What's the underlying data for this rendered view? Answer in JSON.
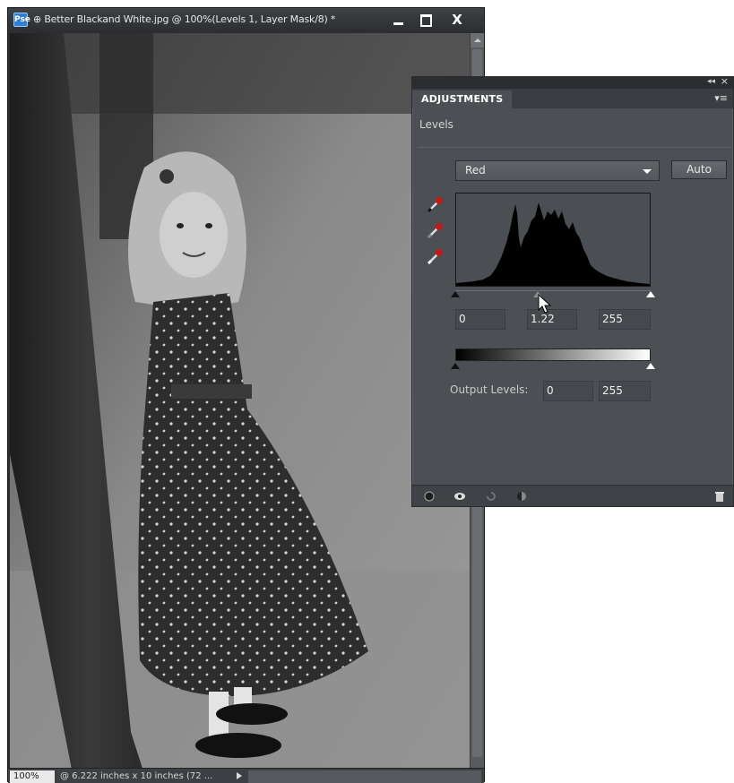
{
  "document": {
    "title": "⊕ Better Blackand White.jpg @ 100%(Levels 1, Layer Mask/8) *",
    "app_icon": "Pse",
    "zoom": "100%",
    "dimensions": "@ 6.222 inches x 10 inches (72 ...",
    "window_buttons": {
      "close": "X"
    }
  },
  "panel": {
    "tab_label": "ADJUSTMENTS",
    "collapse_label": "◂◂",
    "close_label": "×",
    "menu_label": "▾≡",
    "heading": "Levels",
    "channel": "Red",
    "auto_label": "Auto",
    "input_levels": {
      "black": "0",
      "gamma": "1.22",
      "white": "255"
    },
    "output_label": "Output Levels:",
    "output_levels": {
      "low": "0",
      "high": "255"
    }
  },
  "colors": {
    "panel_bg": "#4c4f53",
    "eyedropper_red": "#c21a1a",
    "histogram_fill": "#000000"
  }
}
